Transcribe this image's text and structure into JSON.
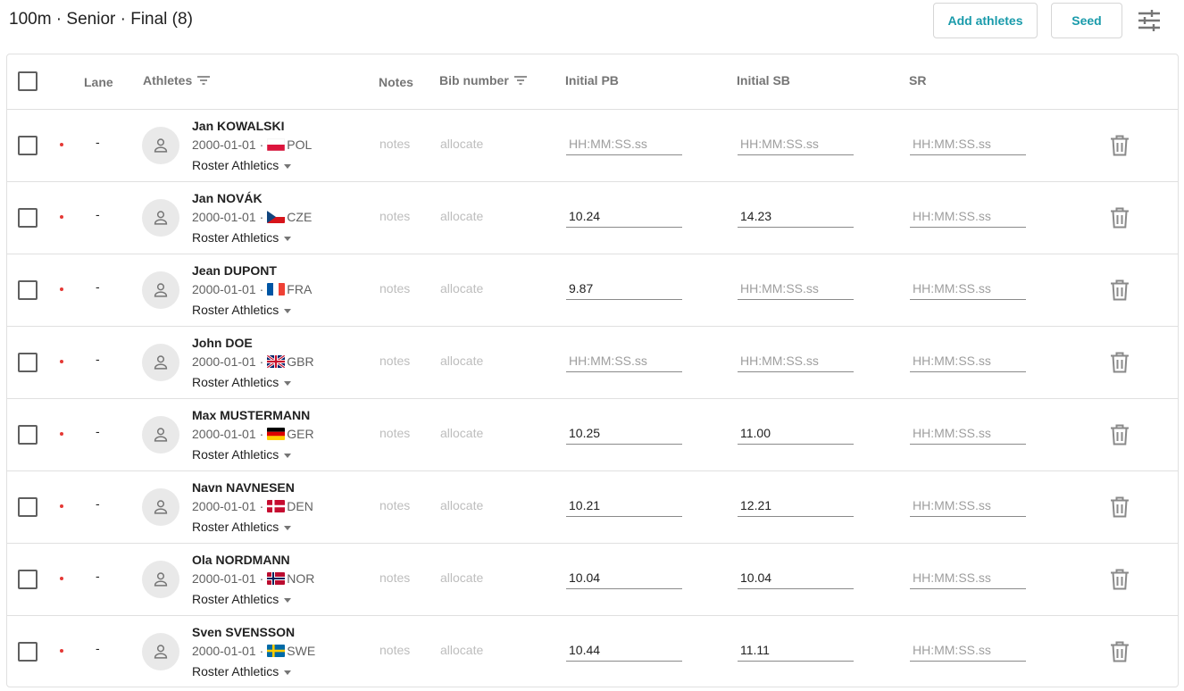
{
  "header": {
    "title": "100m · Senior · Final (8)",
    "add_athletes_label": "Add athletes",
    "seed_label": "Seed"
  },
  "columns": {
    "lane": "Lane",
    "athletes": "Athletes",
    "notes": "Notes",
    "bib": "Bib number",
    "pb": "Initial PB",
    "sb": "Initial SB",
    "sr": "SR"
  },
  "placeholder": "HH:MM:SS.ss",
  "colors": {
    "accent": "#1a9bab",
    "status_dot": "#e53935"
  },
  "athletes": [
    {
      "name": "Jan KOWALSKI",
      "dob": "2000-01-01",
      "sep": "·",
      "country": "POL",
      "flag": "pol",
      "club": "Roster Athletics",
      "lane": "-",
      "notes": "notes",
      "bib": "allocate",
      "pb": "",
      "sb": "",
      "sr": ""
    },
    {
      "name": "Jan NOVÁK",
      "dob": "2000-01-01",
      "sep": "·",
      "country": "CZE",
      "flag": "cze",
      "club": "Roster Athletics",
      "lane": "-",
      "notes": "notes",
      "bib": "allocate",
      "pb": "10.24",
      "sb": "14.23",
      "sr": ""
    },
    {
      "name": "Jean DUPONT",
      "dob": "2000-01-01",
      "sep": "·",
      "country": "FRA",
      "flag": "fra",
      "club": "Roster Athletics",
      "lane": "-",
      "notes": "notes",
      "bib": "allocate",
      "pb": "9.87",
      "sb": "",
      "sr": ""
    },
    {
      "name": "John DOE",
      "dob": "2000-01-01",
      "sep": "·",
      "country": "GBR",
      "flag": "gbr",
      "club": "Roster Athletics",
      "lane": "-",
      "notes": "notes",
      "bib": "allocate",
      "pb": "",
      "sb": "",
      "sr": ""
    },
    {
      "name": "Max MUSTERMANN",
      "dob": "2000-01-01",
      "sep": "·",
      "country": "GER",
      "flag": "ger",
      "club": "Roster Athletics",
      "lane": "-",
      "notes": "notes",
      "bib": "allocate",
      "pb": "10.25",
      "sb": "11.00",
      "sr": ""
    },
    {
      "name": "Navn NAVNESEN",
      "dob": "2000-01-01",
      "sep": "·",
      "country": "DEN",
      "flag": "den",
      "club": "Roster Athletics",
      "lane": "-",
      "notes": "notes",
      "bib": "allocate",
      "pb": "10.21",
      "sb": "12.21",
      "sr": ""
    },
    {
      "name": "Ola NORDMANN",
      "dob": "2000-01-01",
      "sep": "·",
      "country": "NOR",
      "flag": "nor",
      "club": "Roster Athletics",
      "lane": "-",
      "notes": "notes",
      "bib": "allocate",
      "pb": "10.04",
      "sb": "10.04",
      "sr": ""
    },
    {
      "name": "Sven SVENSSON",
      "dob": "2000-01-01",
      "sep": "·",
      "country": "SWE",
      "flag": "swe",
      "club": "Roster Athletics",
      "lane": "-",
      "notes": "notes",
      "bib": "allocate",
      "pb": "10.44",
      "sb": "11.11",
      "sr": ""
    }
  ]
}
